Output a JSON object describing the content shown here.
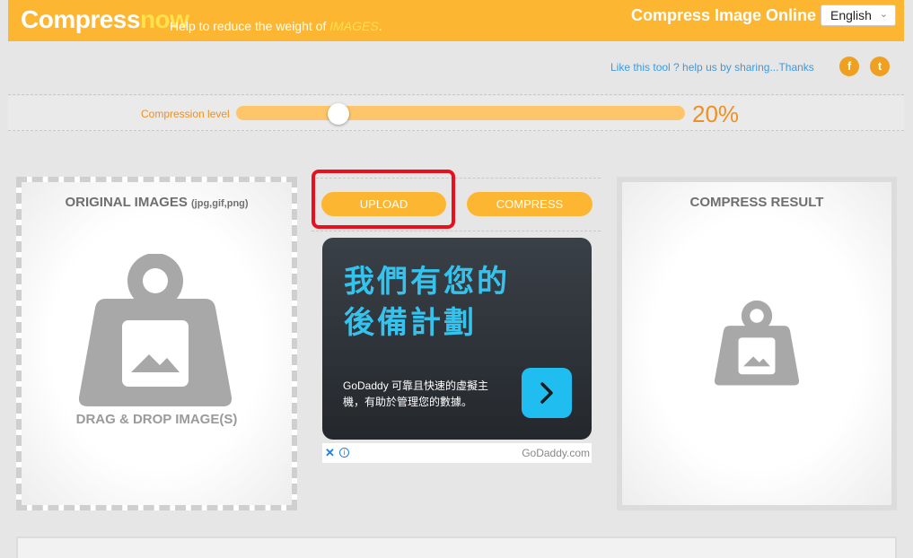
{
  "header": {
    "logo_main": "Compress",
    "logo_accent": "now",
    "tagline_prefix": "Help to reduce the weight of ",
    "tagline_highlight": "IMAGES",
    "tagline_suffix": ".",
    "title": "Compress Image Online",
    "language": "English"
  },
  "share": {
    "text": "Like this tool ? help us by sharing...Thanks",
    "facebook_icon": "f",
    "twitter_icon": "t"
  },
  "compression": {
    "label": "Compression level",
    "value_text": "20%",
    "level": 0.2
  },
  "original": {
    "title": "ORIGINAL IMAGES",
    "formats": "(jpg,gif,png)",
    "drag_text": "DRAG & DROP IMAGE(S)"
  },
  "actions": {
    "upload_label": "UPLOAD",
    "compress_label": "COMPRESS"
  },
  "ad": {
    "headline_line1": "我們有您的",
    "headline_line2": "後備計劃",
    "body": "GoDaddy 可靠且快速的虛擬主機，有助於管理您的數據。",
    "close_icon": "✕",
    "info_icon": "i",
    "brand": "GoDaddy.com"
  },
  "result": {
    "title": "COMPRESS RESULT"
  },
  "colors": {
    "accent": "#fdb632",
    "highlight": "#e8101c",
    "ad_text": "#35c3ee"
  }
}
